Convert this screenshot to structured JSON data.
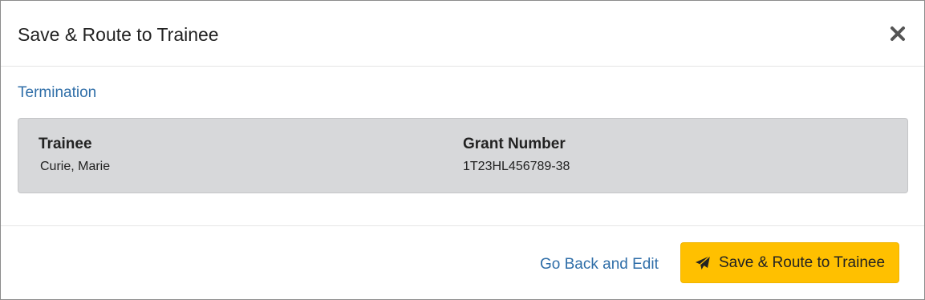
{
  "dialog": {
    "title": "Save & Route to Trainee",
    "close_icon": "close-icon"
  },
  "body": {
    "section_link": "Termination",
    "fields": [
      {
        "label": "Trainee",
        "value": "Curie, Marie"
      },
      {
        "label": "Grant Number",
        "value": "1T23HL456789-38"
      }
    ]
  },
  "footer": {
    "back_label": "Go Back and Edit",
    "primary_label": "Save & Route to Trainee",
    "primary_icon": "paper-plane-icon",
    "primary_color": "#ffc000"
  },
  "colors": {
    "link": "#2f6ea8",
    "panel": "#d7d8da"
  }
}
